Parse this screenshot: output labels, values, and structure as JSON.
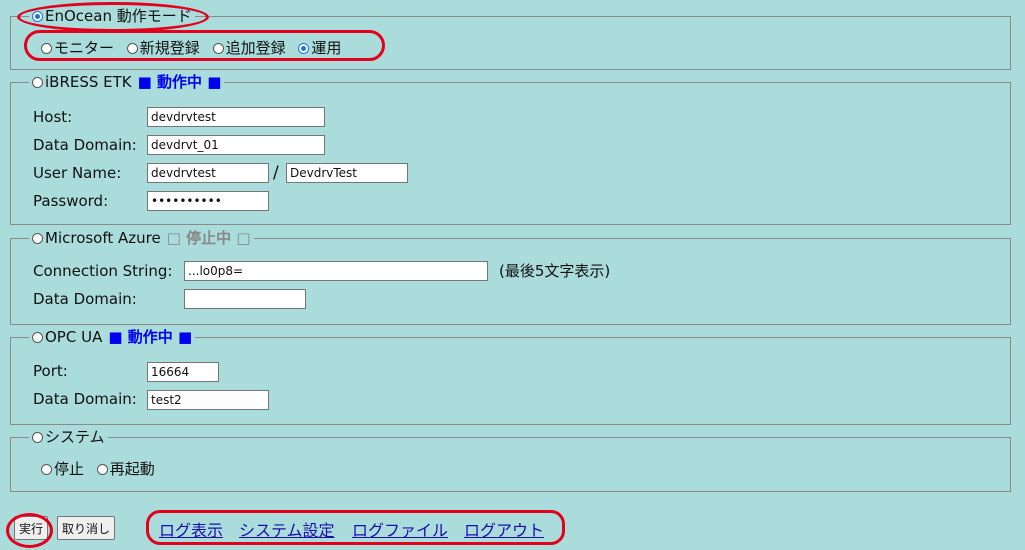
{
  "enocean": {
    "legend": "EnOcean 動作モード",
    "modes": [
      "モニター",
      "新規登録",
      "追加登録",
      "運用"
    ],
    "selected_mode": "運用"
  },
  "ibress": {
    "legend": "iBRESS ETK",
    "status": "■ 動作中 ■",
    "host_label": "Host:",
    "host_value": "devdrvtest",
    "domain_label": "Data Domain:",
    "domain_value": "devdrvt_01",
    "user_label": "User Name:",
    "user_value": "devdrvtest",
    "user_sep": "/",
    "user_value2": "DevdrvTest",
    "password_label": "Password:",
    "password_value": "••••••••••"
  },
  "azure": {
    "legend": "Microsoft Azure",
    "status": "□ 停止中 □",
    "conn_label": "Connection String:",
    "conn_value": "...lo0p8=",
    "conn_note": "(最後5文字表示)",
    "domain_label": "Data Domain:",
    "domain_value": ""
  },
  "opcua": {
    "legend": "OPC UA",
    "status": "■ 動作中 ■",
    "port_label": "Port:",
    "port_value": "16664",
    "domain_label": "Data Domain:",
    "domain_value": "test2"
  },
  "system": {
    "legend": "システム",
    "options": [
      "停止",
      "再起動"
    ]
  },
  "footer": {
    "execute": "実行",
    "cancel": "取り消し",
    "links": [
      "ログ表示",
      "システム設定",
      "ログファイル",
      "ログアウト"
    ]
  },
  "colors": {
    "background": "#aadcdc",
    "active": "#0000ee",
    "inactive": "#888888",
    "highlight": "#e3001b"
  }
}
